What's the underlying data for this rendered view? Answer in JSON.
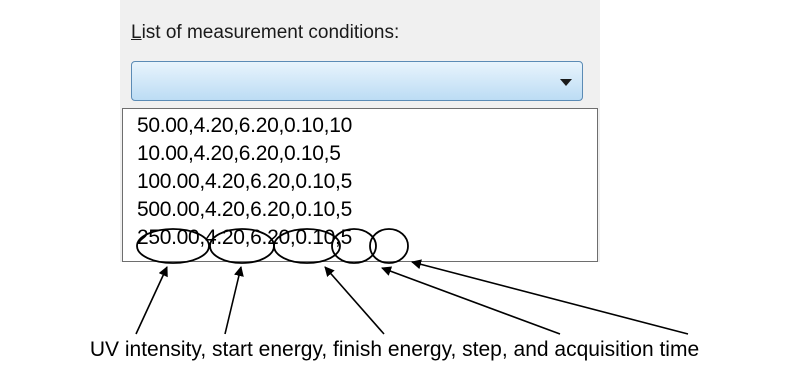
{
  "dialog": {
    "list_label_accel": "L",
    "list_label_rest": "ist of measurement conditions:",
    "combo_value": "",
    "items": [
      "50.00,4.20,6.20,0.10,10",
      "10.00,4.20,6.20,0.10,5",
      "100.00,4.20,6.20,0.10,5",
      "500.00,4.20,6.20,0.10,5",
      "250.00,4.20,6.20,0.10,5"
    ]
  },
  "annotation": {
    "caption": "UV intensity, start energy, finish energy, step, and acquisition time",
    "color": "#000000"
  },
  "icons": {
    "combo_arrow": "chevron-down-icon"
  }
}
